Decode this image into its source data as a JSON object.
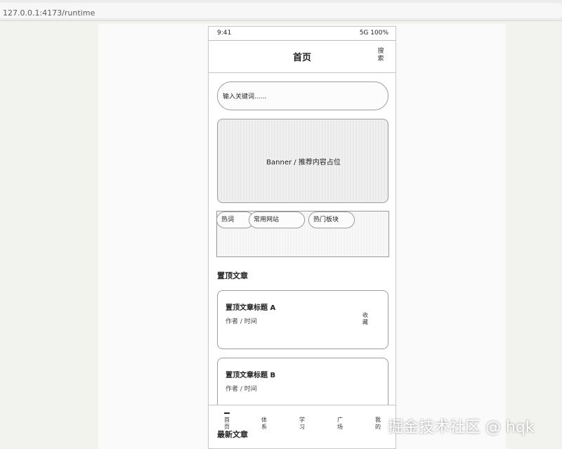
{
  "browser": {
    "url": "127.0.0.1:4173/runtime"
  },
  "status_bar": {
    "time": "9:41",
    "network": "5G 100%"
  },
  "nav_bar": {
    "title": "首页",
    "search_label": "搜索"
  },
  "search": {
    "placeholder": "输入关键词......"
  },
  "banner": {
    "label": "Banner / 推荐内容占位"
  },
  "quick_links": [
    {
      "label": "热词"
    },
    {
      "label": "常用网站"
    },
    {
      "label": "热门板块"
    }
  ],
  "pinned": {
    "section_title": "置顶文章",
    "articles": [
      {
        "title": "置顶文章标题 A",
        "meta": "作者 / 时间",
        "favorite": "收藏"
      },
      {
        "title": "置顶文章标题 B",
        "meta": "作者 / 时间"
      }
    ]
  },
  "latest": {
    "section_title": "最新文章"
  },
  "tab_bar": {
    "tabs": [
      {
        "label": "首页",
        "active": true
      },
      {
        "label": "体系"
      },
      {
        "label": "学习"
      },
      {
        "label": "广场"
      },
      {
        "label": "我的"
      }
    ]
  },
  "watermark": "掘金技术社区 @ hqk"
}
